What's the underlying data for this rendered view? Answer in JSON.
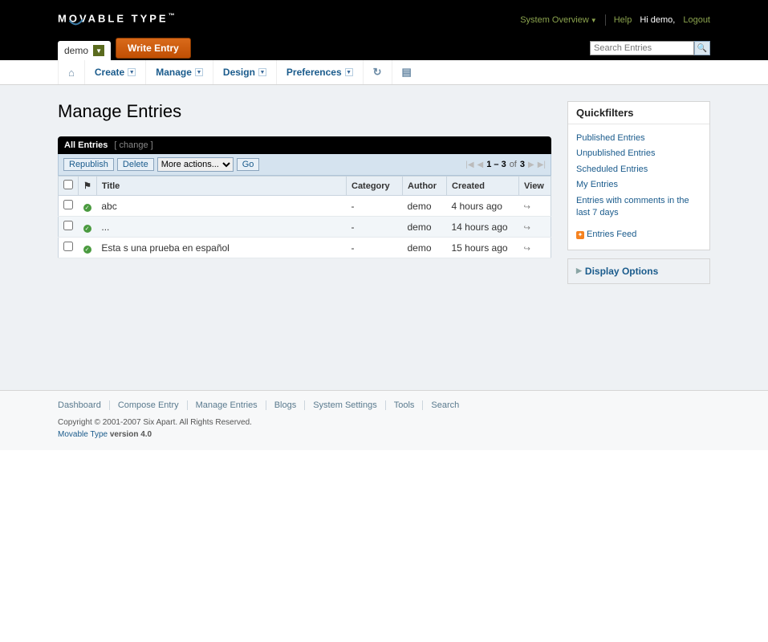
{
  "logo_text": "MOVABLE TYPE",
  "logo_tm": "™",
  "top": {
    "system_overview": "System Overview",
    "help": "Help",
    "greeting": "Hi demo,",
    "logout": "Logout"
  },
  "blog_tab": "demo",
  "write_entry": "Write Entry",
  "search": {
    "placeholder": "Search Entries"
  },
  "nav": {
    "create": "Create",
    "manage": "Manage",
    "design": "Design",
    "preferences": "Preferences"
  },
  "page_title": "Manage Entries",
  "panel": {
    "title": "All Entries",
    "change": "[ change ]"
  },
  "toolbar": {
    "republish": "Republish",
    "delete": "Delete",
    "more_actions": "More actions...",
    "go": "Go"
  },
  "pagination": {
    "range": "1 – 3",
    "of": "of",
    "total": "3"
  },
  "columns": {
    "title": "Title",
    "category": "Category",
    "author": "Author",
    "created": "Created",
    "view": "View"
  },
  "entries": [
    {
      "title": "abc",
      "category": "-",
      "author": "demo",
      "created": "4 hours ago"
    },
    {
      "title": "...",
      "category": "-",
      "author": "demo",
      "created": "14 hours ago"
    },
    {
      "title": "Esta s una prueba en español",
      "category": "-",
      "author": "demo",
      "created": "15 hours ago"
    }
  ],
  "quickfilters": {
    "heading": "Quickfilters",
    "items": [
      "Published Entries",
      "Unpublished Entries",
      "Scheduled Entries",
      "My Entries",
      "Entries with comments in the last 7 days"
    ],
    "feed": "Entries Feed"
  },
  "display_options": "Display Options",
  "footer": {
    "links": [
      "Dashboard",
      "Compose Entry",
      "Manage Entries",
      "Blogs",
      "System Settings",
      "Tools",
      "Search"
    ],
    "copyright": "Copyright © 2001-2007 Six Apart. All Rights Reserved.",
    "product": "Movable Type",
    "version": " version 4.0"
  }
}
